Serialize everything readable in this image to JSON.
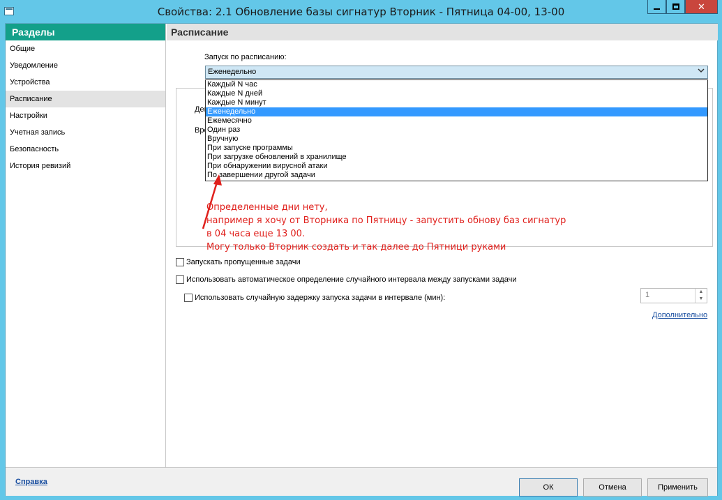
{
  "window": {
    "title": "Свойства: 2.1 Обновление базы сигнатур Вторник - Пятница 04-00, 13-00",
    "close_glyph": "✕"
  },
  "sidebar": {
    "header": "Разделы",
    "items": [
      {
        "label": "Общие"
      },
      {
        "label": "Уведомление"
      },
      {
        "label": "Устройства"
      },
      {
        "label": "Расписание"
      },
      {
        "label": "Настройки"
      },
      {
        "label": "Учетная запись"
      },
      {
        "label": "Безопасность"
      },
      {
        "label": "История ревизий"
      }
    ],
    "active_index": 3
  },
  "main": {
    "header": "Расписание",
    "schedule_label": "Запуск по расписанию:",
    "schedule_value": "Еженедельно",
    "dropdown_options": [
      "Каждый N час",
      "Каждые N дней",
      "Каждые N минут",
      "Еженедельно",
      "Ежемесячно",
      "Один раз",
      "Вручную",
      "При запуске программы",
      "При загрузке обновлений в хранилище",
      "При обнаружении вирусной атаки",
      "По завершении другой задачи"
    ],
    "selected_option_index": 3,
    "group_labels": {
      "day": "День",
      "time": "Время"
    },
    "annotation_lines": [
      "Определенные дни нету,",
      "например я хочу от Вторника по Пятницу - запустить обнову баз сигнатур",
      "в 04 часа еще 13 00.",
      "Могу только Вторник создать и так далее до Пятници руками"
    ],
    "run_missed_label": "Запускать пропущенные задачи",
    "auto_interval_label": "Использовать автоматическое определение случайного интервала между запусками задачи",
    "random_delay_label": "Использовать случайную задержку запуска задачи в интервале (мин):",
    "random_delay_value": "1",
    "advanced_link": "Дополнительно"
  },
  "footer": {
    "help_link": "Справка",
    "ok": "ОК",
    "cancel": "Отмена",
    "apply": "Применить"
  },
  "colors": {
    "titlebar": "#63c7e8",
    "sidebar_header": "#13a08a",
    "selected_option": "#3399ff",
    "annotation": "#e0201c",
    "close_button": "#c9463d"
  }
}
